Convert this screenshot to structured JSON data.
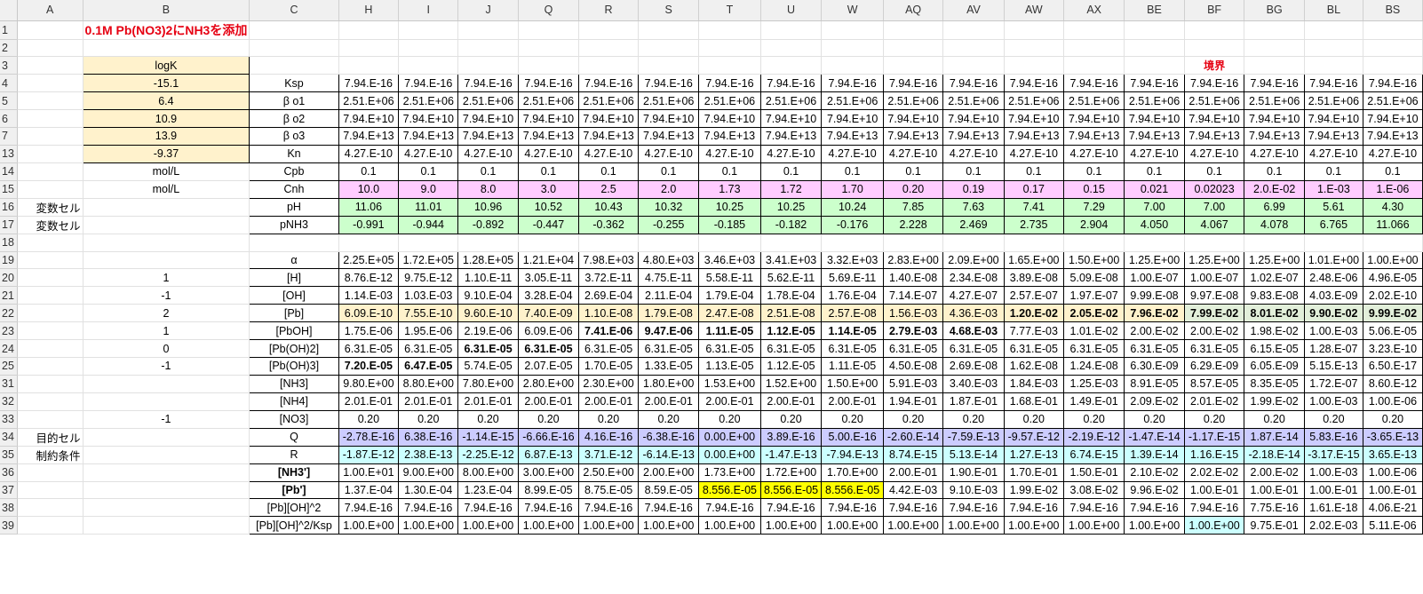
{
  "columns": [
    "A",
    "B",
    "C",
    "H",
    "I",
    "J",
    "Q",
    "R",
    "S",
    "T",
    "U",
    "W",
    "AQ",
    "AV",
    "AW",
    "AX",
    "BE",
    "BF",
    "BG",
    "BL",
    "BS"
  ],
  "title": "0.1M Pb(NO3)2にNH3を添加",
  "boundary_label": "境界",
  "logK_header": "logK",
  "colors": {
    "title": "#e60012",
    "yellow": "#fff2cc",
    "pink": "#ffccff",
    "green": "#ccffcc",
    "lilac": "#ccccff",
    "cyan": "#ccffff",
    "highlight": "#ffff00"
  },
  "rows": [
    {
      "num": "1",
      "cells": []
    },
    {
      "num": "2",
      "cells": []
    },
    {
      "num": "3",
      "cells": []
    },
    {
      "num": "4",
      "a": "",
      "b": "-15.1",
      "c": "Ksp",
      "v": [
        "7.94.E-16",
        "7.94.E-16",
        "7.94.E-16",
        "7.94.E-16",
        "7.94.E-16",
        "7.94.E-16",
        "7.94.E-16",
        "7.94.E-16",
        "7.94.E-16",
        "7.94.E-16",
        "7.94.E-16",
        "7.94.E-16",
        "7.94.E-16",
        "7.94.E-16",
        "7.94.E-16",
        "7.94.E-16",
        "7.94.E-16",
        "7.94.E-16"
      ]
    },
    {
      "num": "5",
      "a": "",
      "b": "6.4",
      "c": "β o1",
      "v": [
        "2.51.E+06",
        "2.51.E+06",
        "2.51.E+06",
        "2.51.E+06",
        "2.51.E+06",
        "2.51.E+06",
        "2.51.E+06",
        "2.51.E+06",
        "2.51.E+06",
        "2.51.E+06",
        "2.51.E+06",
        "2.51.E+06",
        "2.51.E+06",
        "2.51.E+06",
        "2.51.E+06",
        "2.51.E+06",
        "2.51.E+06",
        "2.51.E+06"
      ]
    },
    {
      "num": "6",
      "a": "",
      "b": "10.9",
      "c": "β o2",
      "v": [
        "7.94.E+10",
        "7.94.E+10",
        "7.94.E+10",
        "7.94.E+10",
        "7.94.E+10",
        "7.94.E+10",
        "7.94.E+10",
        "7.94.E+10",
        "7.94.E+10",
        "7.94.E+10",
        "7.94.E+10",
        "7.94.E+10",
        "7.94.E+10",
        "7.94.E+10",
        "7.94.E+10",
        "7.94.E+10",
        "7.94.E+10",
        "7.94.E+10"
      ]
    },
    {
      "num": "7",
      "a": "",
      "b": "13.9",
      "c": "β o3",
      "v": [
        "7.94.E+13",
        "7.94.E+13",
        "7.94.E+13",
        "7.94.E+13",
        "7.94.E+13",
        "7.94.E+13",
        "7.94.E+13",
        "7.94.E+13",
        "7.94.E+13",
        "7.94.E+13",
        "7.94.E+13",
        "7.94.E+13",
        "7.94.E+13",
        "7.94.E+13",
        "7.94.E+13",
        "7.94.E+13",
        "7.94.E+13",
        "7.94.E+13"
      ]
    },
    {
      "num": "13",
      "a": "",
      "b": "-9.37",
      "c": "Kn",
      "v": [
        "4.27.E-10",
        "4.27.E-10",
        "4.27.E-10",
        "4.27.E-10",
        "4.27.E-10",
        "4.27.E-10",
        "4.27.E-10",
        "4.27.E-10",
        "4.27.E-10",
        "4.27.E-10",
        "4.27.E-10",
        "4.27.E-10",
        "4.27.E-10",
        "4.27.E-10",
        "4.27.E-10",
        "4.27.E-10",
        "4.27.E-10",
        "4.27.E-10"
      ]
    },
    {
      "num": "14",
      "a": "",
      "b": "mol/L",
      "c": "Cpb",
      "v": [
        "0.1",
        "0.1",
        "0.1",
        "0.1",
        "0.1",
        "0.1",
        "0.1",
        "0.1",
        "0.1",
        "0.1",
        "0.1",
        "0.1",
        "0.1",
        "0.1",
        "0.1",
        "0.1",
        "0.1",
        "0.1"
      ]
    },
    {
      "num": "15",
      "a": "",
      "b": "mol/L",
      "c": "Cnh",
      "v": [
        "10.0",
        "9.0",
        "8.0",
        "3.0",
        "2.5",
        "2.0",
        "1.73",
        "1.72",
        "1.70",
        "0.20",
        "0.19",
        "0.17",
        "0.15",
        "0.021",
        "0.02023",
        "2.0.E-02",
        "1.E-03",
        "1.E-06"
      ]
    },
    {
      "num": "16",
      "a": "変数セル",
      "b": "",
      "c": "pH",
      "v": [
        "11.06",
        "11.01",
        "10.96",
        "10.52",
        "10.43",
        "10.32",
        "10.25",
        "10.25",
        "10.24",
        "7.85",
        "7.63",
        "7.41",
        "7.29",
        "7.00",
        "7.00",
        "6.99",
        "5.61",
        "4.30"
      ]
    },
    {
      "num": "17",
      "a": "変数セル",
      "b": "",
      "c": "pNH3",
      "v": [
        "-0.991",
        "-0.944",
        "-0.892",
        "-0.447",
        "-0.362",
        "-0.255",
        "-0.185",
        "-0.182",
        "-0.176",
        "2.228",
        "2.469",
        "2.735",
        "2.904",
        "4.050",
        "4.067",
        "4.078",
        "6.765",
        "11.066"
      ]
    },
    {
      "num": "18",
      "cells": []
    },
    {
      "num": "19",
      "a": "",
      "b": "",
      "c": "α",
      "v": [
        "2.25.E+05",
        "1.72.E+05",
        "1.28.E+05",
        "1.21.E+04",
        "7.98.E+03",
        "4.80.E+03",
        "3.46.E+03",
        "3.41.E+03",
        "3.32.E+03",
        "2.83.E+00",
        "2.09.E+00",
        "1.65.E+00",
        "1.50.E+00",
        "1.25.E+00",
        "1.25.E+00",
        "1.25.E+00",
        "1.01.E+00",
        "1.00.E+00"
      ]
    },
    {
      "num": "20",
      "a": "",
      "b": "1",
      "c": "[H]",
      "v": [
        "8.76.E-12",
        "9.75.E-12",
        "1.10.E-11",
        "3.05.E-11",
        "3.72.E-11",
        "4.75.E-11",
        "5.58.E-11",
        "5.62.E-11",
        "5.69.E-11",
        "1.40.E-08",
        "2.34.E-08",
        "3.89.E-08",
        "5.09.E-08",
        "1.00.E-07",
        "1.00.E-07",
        "1.02.E-07",
        "2.48.E-06",
        "4.96.E-05"
      ]
    },
    {
      "num": "21",
      "a": "",
      "b": "-1",
      "c": "[OH]",
      "v": [
        "1.14.E-03",
        "1.03.E-03",
        "9.10.E-04",
        "3.28.E-04",
        "2.69.E-04",
        "2.11.E-04",
        "1.79.E-04",
        "1.78.E-04",
        "1.76.E-04",
        "7.14.E-07",
        "4.27.E-07",
        "2.57.E-07",
        "1.97.E-07",
        "9.99.E-08",
        "9.97.E-08",
        "9.83.E-08",
        "4.03.E-09",
        "2.02.E-10"
      ]
    },
    {
      "num": "22",
      "a": "",
      "b": "2",
      "c": "[Pb]",
      "v": [
        "6.09.E-10",
        "7.55.E-10",
        "9.60.E-10",
        "7.40.E-09",
        "1.10.E-08",
        "1.79.E-08",
        "2.47.E-08",
        "2.51.E-08",
        "2.57.E-08",
        "1.56.E-03",
        "4.36.E-03",
        "1.20.E-02",
        "2.05.E-02",
        "7.96.E-02",
        "7.99.E-02",
        "8.01.E-02",
        "9.90.E-02",
        "9.99.E-02"
      ]
    },
    {
      "num": "23",
      "a": "",
      "b": "1",
      "c": "[PbOH]",
      "v": [
        "1.75.E-06",
        "1.95.E-06",
        "2.19.E-06",
        "6.09.E-06",
        "7.41.E-06",
        "9.47.E-06",
        "1.11.E-05",
        "1.12.E-05",
        "1.14.E-05",
        "2.79.E-03",
        "4.68.E-03",
        "7.77.E-03",
        "1.01.E-02",
        "2.00.E-02",
        "2.00.E-02",
        "1.98.E-02",
        "1.00.E-03",
        "5.06.E-05"
      ]
    },
    {
      "num": "24",
      "a": "",
      "b": "0",
      "c": "[Pb(OH)2]",
      "v": [
        "6.31.E-05",
        "6.31.E-05",
        "6.31.E-05",
        "6.31.E-05",
        "6.31.E-05",
        "6.31.E-05",
        "6.31.E-05",
        "6.31.E-05",
        "6.31.E-05",
        "6.31.E-05",
        "6.31.E-05",
        "6.31.E-05",
        "6.31.E-05",
        "6.31.E-05",
        "6.31.E-05",
        "6.15.E-05",
        "1.28.E-07",
        "3.23.E-10"
      ]
    },
    {
      "num": "25",
      "a": "",
      "b": "-1",
      "c": "[Pb(OH)3]",
      "v": [
        "7.20.E-05",
        "6.47.E-05",
        "5.74.E-05",
        "2.07.E-05",
        "1.70.E-05",
        "1.33.E-05",
        "1.13.E-05",
        "1.12.E-05",
        "1.11.E-05",
        "4.50.E-08",
        "2.69.E-08",
        "1.62.E-08",
        "1.24.E-08",
        "6.30.E-09",
        "6.29.E-09",
        "6.05.E-09",
        "5.15.E-13",
        "6.50.E-17"
      ]
    },
    {
      "num": "31",
      "a": "",
      "b": "",
      "c": "[NH3]",
      "v": [
        "9.80.E+00",
        "8.80.E+00",
        "7.80.E+00",
        "2.80.E+00",
        "2.30.E+00",
        "1.80.E+00",
        "1.53.E+00",
        "1.52.E+00",
        "1.50.E+00",
        "5.91.E-03",
        "3.40.E-03",
        "1.84.E-03",
        "1.25.E-03",
        "8.91.E-05",
        "8.57.E-05",
        "8.35.E-05",
        "1.72.E-07",
        "8.60.E-12"
      ]
    },
    {
      "num": "32",
      "a": "",
      "b": "",
      "c": "[NH4]",
      "v": [
        "2.01.E-01",
        "2.01.E-01",
        "2.01.E-01",
        "2.00.E-01",
        "2.00.E-01",
        "2.00.E-01",
        "2.00.E-01",
        "2.00.E-01",
        "2.00.E-01",
        "1.94.E-01",
        "1.87.E-01",
        "1.68.E-01",
        "1.49.E-01",
        "2.09.E-02",
        "2.01.E-02",
        "1.99.E-02",
        "1.00.E-03",
        "1.00.E-06"
      ]
    },
    {
      "num": "33",
      "a": "",
      "b": "-1",
      "c": "[NO3]",
      "v": [
        "0.20",
        "0.20",
        "0.20",
        "0.20",
        "0.20",
        "0.20",
        "0.20",
        "0.20",
        "0.20",
        "0.20",
        "0.20",
        "0.20",
        "0.20",
        "0.20",
        "0.20",
        "0.20",
        "0.20",
        "0.20"
      ]
    },
    {
      "num": "34",
      "a": "目的セル",
      "b": "",
      "c": "Q",
      "v": [
        "-2.78.E-16",
        "6.38.E-16",
        "-1.14.E-15",
        "-6.66.E-16",
        "4.16.E-16",
        "-6.38.E-16",
        "0.00.E+00",
        "3.89.E-16",
        "5.00.E-16",
        "-2.60.E-14",
        "-7.59.E-13",
        "-9.57.E-12",
        "-2.19.E-12",
        "-1.47.E-14",
        "-1.17.E-15",
        "1.87.E-14",
        "5.83.E-16",
        "-3.65.E-13"
      ]
    },
    {
      "num": "35",
      "a": "制約条件",
      "b": "",
      "c": "R",
      "v": [
        "-1.87.E-12",
        "2.38.E-13",
        "-2.25.E-12",
        "6.87.E-13",
        "3.71.E-12",
        "-6.14.E-13",
        "0.00.E+00",
        "-1.47.E-13",
        "-7.94.E-13",
        "8.74.E-15",
        "5.13.E-14",
        "1.27.E-13",
        "6.74.E-15",
        "1.39.E-14",
        "1.16.E-15",
        "-2.18.E-14",
        "-3.17.E-15",
        "3.65.E-13"
      ]
    },
    {
      "num": "36",
      "a": "",
      "b": "",
      "c": "[NH3']",
      "v": [
        "1.00.E+01",
        "9.00.E+00",
        "8.00.E+00",
        "3.00.E+00",
        "2.50.E+00",
        "2.00.E+00",
        "1.73.E+00",
        "1.72.E+00",
        "1.70.E+00",
        "2.00.E-01",
        "1.90.E-01",
        "1.70.E-01",
        "1.50.E-01",
        "2.10.E-02",
        "2.02.E-02",
        "2.00.E-02",
        "1.00.E-03",
        "1.00.E-06"
      ]
    },
    {
      "num": "37",
      "a": "",
      "b": "",
      "c": "[Pb']",
      "v": [
        "1.37.E-04",
        "1.30.E-04",
        "1.23.E-04",
        "8.99.E-05",
        "8.75.E-05",
        "8.59.E-05",
        "8.556.E-05",
        "8.556.E-05",
        "8.556.E-05",
        "4.42.E-03",
        "9.10.E-03",
        "1.99.E-02",
        "3.08.E-02",
        "9.96.E-02",
        "1.00.E-01",
        "1.00.E-01",
        "1.00.E-01",
        "1.00.E-01"
      ]
    },
    {
      "num": "38",
      "a": "",
      "b": "",
      "c": "[Pb][OH]^2",
      "v": [
        "7.94.E-16",
        "7.94.E-16",
        "7.94.E-16",
        "7.94.E-16",
        "7.94.E-16",
        "7.94.E-16",
        "7.94.E-16",
        "7.94.E-16",
        "7.94.E-16",
        "7.94.E-16",
        "7.94.E-16",
        "7.94.E-16",
        "7.94.E-16",
        "7.94.E-16",
        "7.94.E-16",
        "7.75.E-16",
        "1.61.E-18",
        "4.06.E-21"
      ]
    },
    {
      "num": "39",
      "a": "",
      "b": "",
      "c": "[Pb][OH]^2/Ksp",
      "v": [
        "1.00.E+00",
        "1.00.E+00",
        "1.00.E+00",
        "1.00.E+00",
        "1.00.E+00",
        "1.00.E+00",
        "1.00.E+00",
        "1.00.E+00",
        "1.00.E+00",
        "1.00.E+00",
        "1.00.E+00",
        "1.00.E+00",
        "1.00.E+00",
        "1.00.E+00",
        "1.00.E+00",
        "9.75.E-01",
        "2.02.E-03",
        "5.11.E-06"
      ]
    }
  ]
}
